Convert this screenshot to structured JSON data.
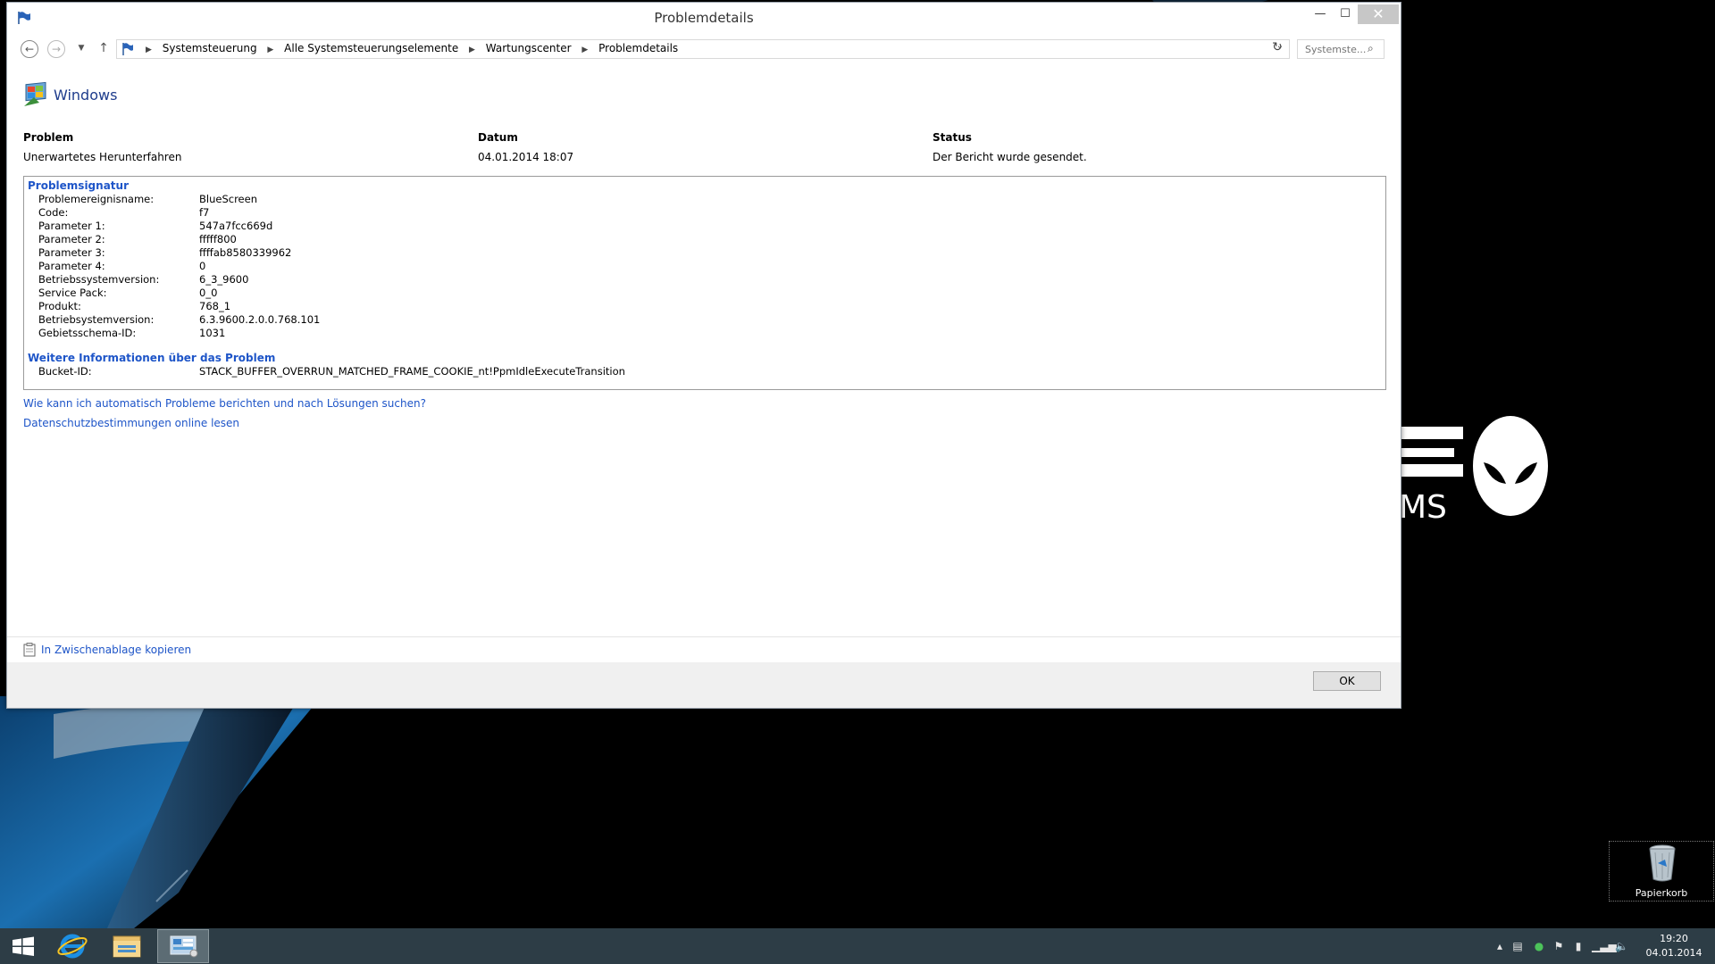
{
  "window": {
    "title": "Problemdetails",
    "minimize_label": "—",
    "maximize_label": "☐",
    "close_label": "✕"
  },
  "nav": {
    "breadcrumb": [
      "Systemsteuerung",
      "Alle Systemsteuerungselemente",
      "Wartungscenter",
      "Problemdetails"
    ],
    "search_placeholder": "Systemste..."
  },
  "header": {
    "product_name": "Windows"
  },
  "summary": {
    "problem_label": "Problem",
    "problem_value": "Unerwartetes Herunterfahren",
    "date_label": "Datum",
    "date_value": "04.01.2014 18:07",
    "status_label": "Status",
    "status_value": "Der Bericht wurde gesendet."
  },
  "signature": {
    "title": "Problemsignatur",
    "rows": [
      {
        "label": "Problemereignisname:",
        "value": "BlueScreen"
      },
      {
        "label": "Code:",
        "value": "f7"
      },
      {
        "label": "Parameter 1:",
        "value": "547a7fcc669d"
      },
      {
        "label": "Parameter 2:",
        "value": "fffff800"
      },
      {
        "label": "Parameter 3:",
        "value": "ffffab8580339962"
      },
      {
        "label": "Parameter 4:",
        "value": "0"
      },
      {
        "label": "Betriebssystemversion:",
        "value": "6_3_9600"
      },
      {
        "label": "Service Pack:",
        "value": "0_0"
      },
      {
        "label": "Produkt:",
        "value": "768_1"
      },
      {
        "label": "Betriebsystemversion:",
        "value": "6.3.9600.2.0.0.768.101"
      },
      {
        "label": "Gebietsschema-ID:",
        "value": "1031"
      }
    ]
  },
  "more_info": {
    "title": "Weitere Informationen über das Problem",
    "bucket_label": "Bucket-ID:",
    "bucket_value": "STACK_BUFFER_OVERRUN_MATCHED_FRAME_COOKIE_nt!PpmIdleExecuteTransition"
  },
  "links": {
    "auto_report": "Wie kann ich automatisch Probleme berichten und nach Lösungen suchen?",
    "privacy": "Datenschutzbestimmungen online lesen",
    "copy": "In Zwischenablage kopieren"
  },
  "footer": {
    "ok_label": "OK"
  },
  "desktop": {
    "recycle_label": "Papierkorb"
  },
  "taskbar": {
    "time": "19:20",
    "date": "04.01.2014"
  }
}
